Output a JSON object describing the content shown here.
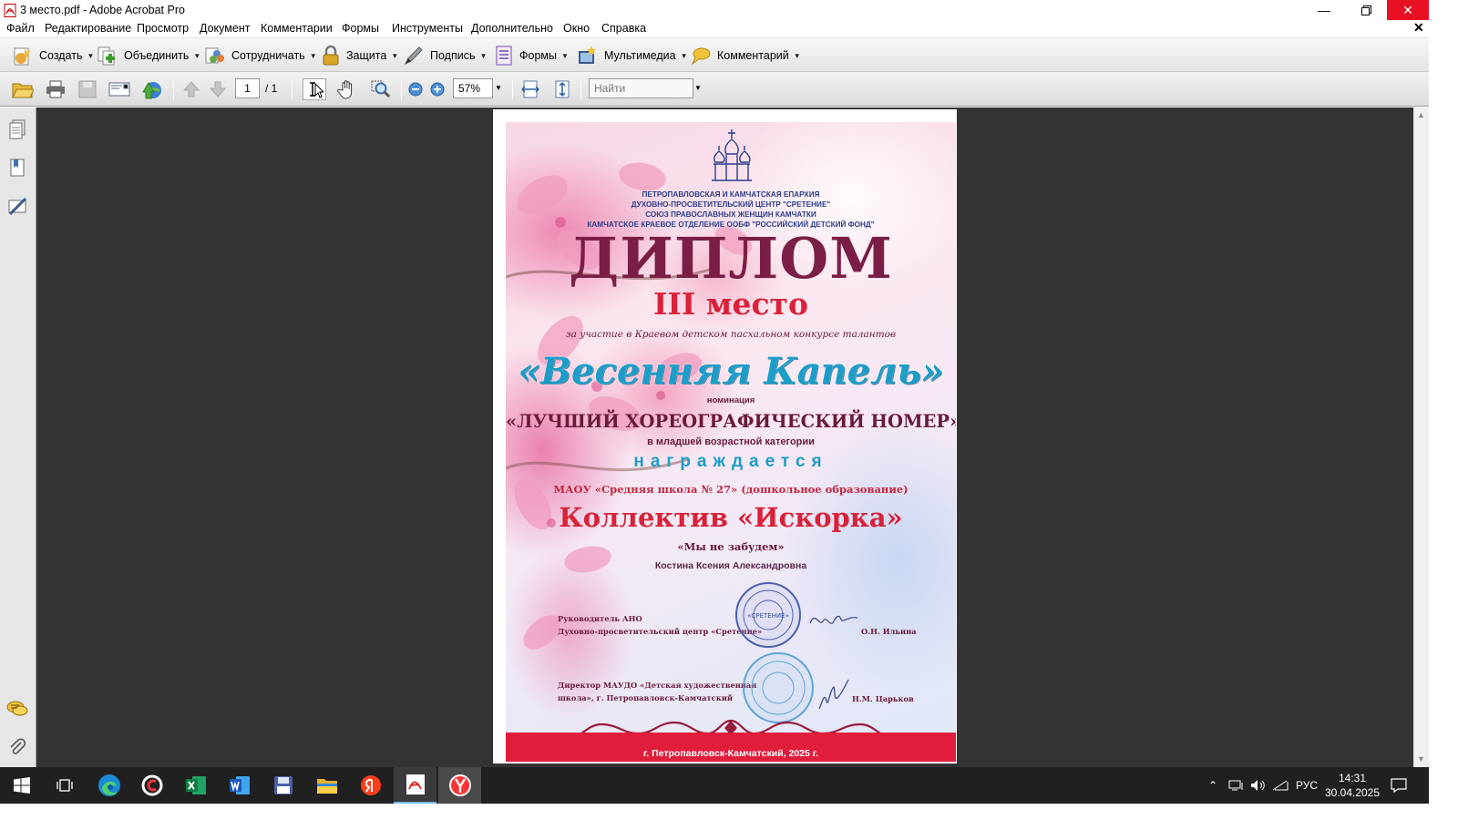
{
  "window": {
    "title": "3 место.pdf - Adobe Acrobat Pro"
  },
  "menu": [
    "Файл",
    "Редактирование",
    "Просмотр",
    "Документ",
    "Комментарии",
    "Формы",
    "Инструменты",
    "Дополнительно",
    "Окно",
    "Справка"
  ],
  "toolbar": {
    "create": "Создать",
    "combine": "Объединить",
    "collaborate": "Сотрудничать",
    "protect": "Защита",
    "sign": "Подпись",
    "forms": "Формы",
    "multimedia": "Мультимедиа",
    "comment": "Комментарий"
  },
  "nav": {
    "page_current": "1",
    "page_total": "/ 1",
    "zoom": "57%",
    "find_placeholder": "Найти"
  },
  "certificate": {
    "org_lines": [
      "ПЕТРОПАВЛОВСКАЯ И КАМЧАТСКАЯ ЕПАРХИЯ",
      "ДУХОВНО-ПРОСВЕТИТЕЛЬСКИЙ ЦЕНТР \"СРЕТЕНИЕ\"",
      "СОЮЗ ПРАВОСЛАВНЫХ ЖЕНЩИН КАМЧАТКИ",
      "КАМЧАТСКОЕ КРАЕВОЕ ОТДЕЛЕНИЕ ООБФ \"РОССИЙСКИЙ ДЕТСКИЙ ФОНД\""
    ],
    "heading": "ДИПЛОМ",
    "place": "III место",
    "participation": "за участие в Краевом детском пасхальном конкурсе талантов",
    "contest": "«Весенняя Капель»",
    "nomination_label": "номинация",
    "nomination": "«ЛУЧШИЙ ХОРЕОГРАФИЧЕСКИЙ НОМЕР»",
    "age_category": "в младшей возрастной категории",
    "awarded": "награждается",
    "school": "МАОУ «Средняя школа № 27» (дошкольное образование)",
    "collective": "Коллектив «Искорка»",
    "piece": "«Мы не забудем»",
    "teacher": "Костина Ксения Александровна",
    "signer1_title_line1": "Руководитель АНО",
    "signer1_title_line2": "Духовно-просветительский центр «Сретение»",
    "signer1_name": "О.Н. Ильина",
    "stamp1_text": "«СРЕТЕНИЕ»",
    "signer2_title_line1": "Директор МАУДО «Детская художественная",
    "signer2_title_line2": "школа», г. Петропавловск-Камчатский",
    "signer2_name": "Н.М. Царьков",
    "city_year": "г. Петропавловск-Камчатский, 2025 г."
  },
  "taskbar": {
    "lang": "РУС",
    "time": "14:31",
    "date": "30.04.2025"
  },
  "colors": {
    "viewer_bg": "#333333",
    "taskbar_bg": "#202020",
    "close_red": "#e81123",
    "cert_red": "#d8223a",
    "cert_blue": "#1d9cc8",
    "cert_maroon": "#7b1e46"
  }
}
